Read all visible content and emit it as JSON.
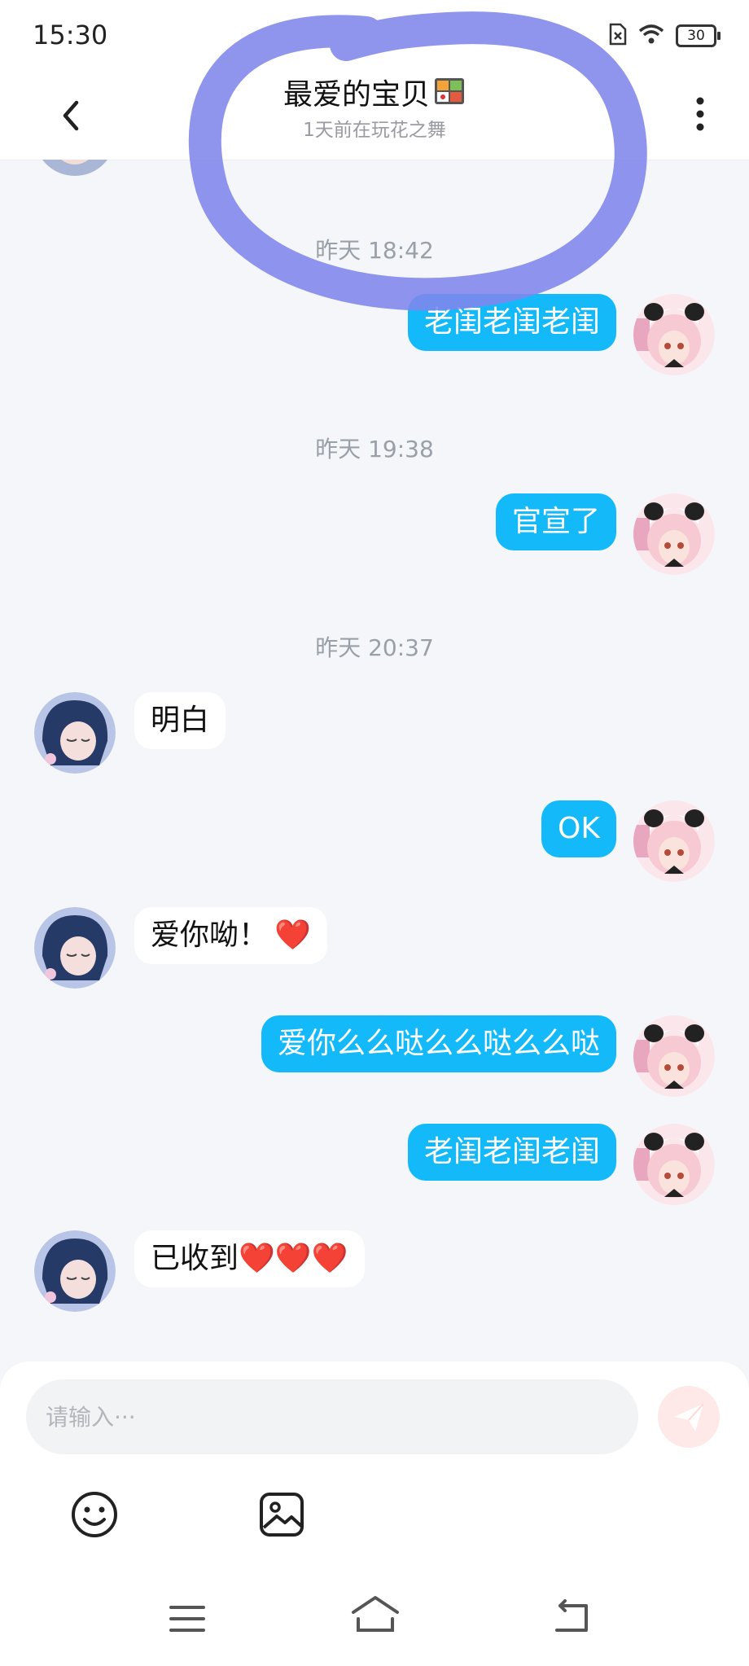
{
  "status_bar": {
    "time": "15:30",
    "battery": "30"
  },
  "header": {
    "title": "最爱的宝贝",
    "subtitle": "1天前在玩花之舞"
  },
  "messages": [
    {
      "type": "timestamp",
      "text": "昨天 18:42"
    },
    {
      "type": "out",
      "text": "老闺老闺老闺"
    },
    {
      "type": "timestamp",
      "text": "昨天 19:38"
    },
    {
      "type": "out",
      "text": "官宣了"
    },
    {
      "type": "timestamp",
      "text": "昨天 20:37"
    },
    {
      "type": "in",
      "text": "明白"
    },
    {
      "type": "out",
      "text": "OK"
    },
    {
      "type": "in",
      "text": "爱你呦！",
      "hearts": "❤️"
    },
    {
      "type": "out",
      "text": "爱你么么哒么么哒么么哒"
    },
    {
      "type": "out",
      "text": "老闺老闺老闺"
    },
    {
      "type": "in",
      "text": "已收到",
      "hearts": "❤️❤️❤️"
    }
  ],
  "composer": {
    "placeholder": "请输入···"
  },
  "colors": {
    "outgoing_bubble": "#14b9f9",
    "incoming_bubble": "#ffffff",
    "background": "#f4f6f9",
    "annotation": "#7f86ea"
  },
  "icons": [
    "back-icon",
    "more-icon",
    "lunch-box-emoji",
    "send-icon",
    "smiley-icon",
    "image-icon",
    "menu-icon",
    "home-icon",
    "return-icon"
  ]
}
